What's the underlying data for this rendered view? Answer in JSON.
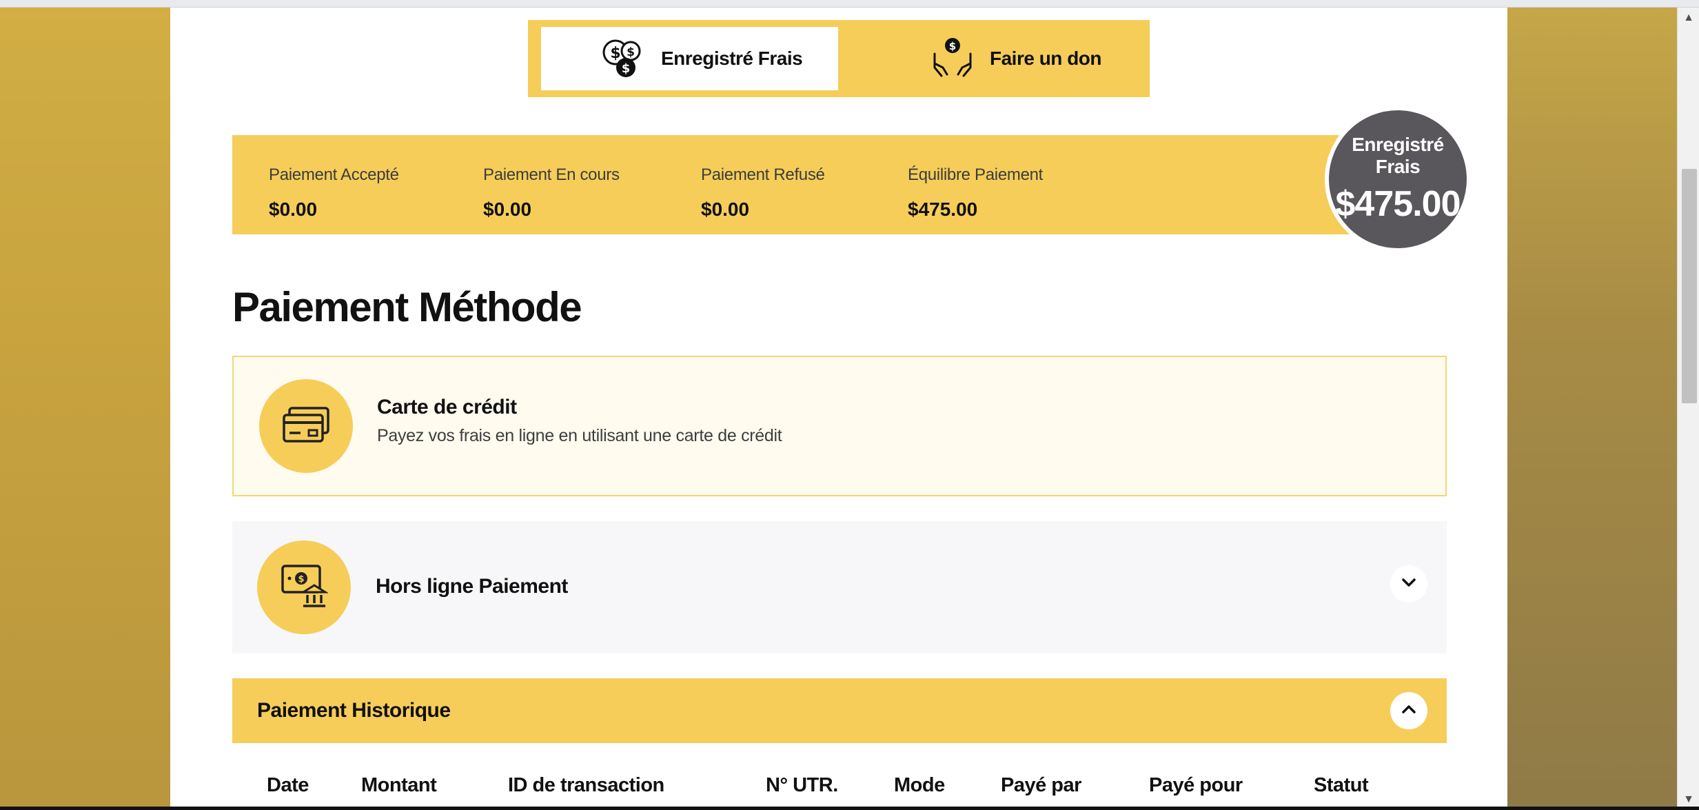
{
  "tabs": [
    {
      "label": "Enregistré Frais",
      "icon": "coins-icon",
      "active": true
    },
    {
      "label": "Faire un don",
      "icon": "donation-hands-icon",
      "active": false
    }
  ],
  "summary": {
    "stats": [
      {
        "label": "Paiement Accepté",
        "value": "$0.00"
      },
      {
        "label": "Paiement En cours",
        "value": "$0.00"
      },
      {
        "label": "Paiement Refusé",
        "value": "$0.00"
      },
      {
        "label": "Équilibre Paiement",
        "value": "$475.00"
      }
    ],
    "badge": {
      "label": "Enregistré Frais",
      "amount": "$475.00"
    }
  },
  "section_title": "Paiement Méthode",
  "methods": {
    "card": {
      "title": "Carte de crédit",
      "description": "Payez vos frais en ligne en utilisant une carte de crédit",
      "icon": "credit-card-icon"
    },
    "offline": {
      "title": "Hors ligne Paiement",
      "icon": "bank-transfer-icon"
    }
  },
  "history": {
    "title": "Paiement Historique",
    "columns": [
      "Date",
      "Montant",
      "ID de transaction",
      "N° UTR.",
      "Mode",
      "Payé par",
      "Payé pour",
      "Statut"
    ]
  },
  "colors": {
    "accent": "#f6cd59",
    "badge": "#59575b",
    "background": "#c9a63f"
  }
}
